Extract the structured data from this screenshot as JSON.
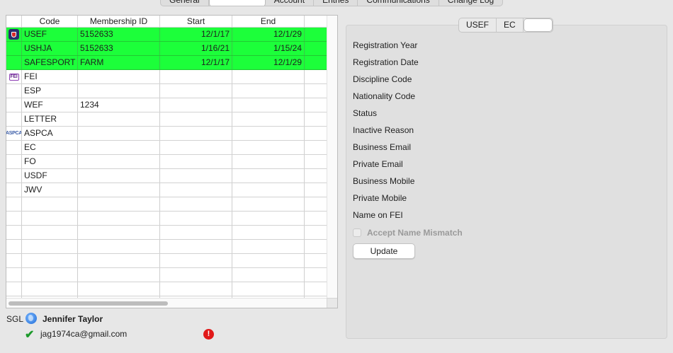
{
  "top_tabs": [
    "General",
    "",
    "Account",
    "Entries",
    "Communications",
    "Change Log"
  ],
  "table": {
    "headers": [
      "Code",
      "Membership ID",
      "Start",
      "End"
    ],
    "highlight_color": "#1cff3a",
    "rows": [
      {
        "icon": "usef-logo",
        "code": "USEF",
        "membership_id": "5152633",
        "start": "12/1/17",
        "end": "12/1/29",
        "highlight": true
      },
      {
        "icon": "",
        "code": "USHJA",
        "membership_id": "5152633",
        "start": "1/16/21",
        "end": "1/15/24",
        "highlight": true
      },
      {
        "icon": "",
        "code": "SAFESPORT",
        "membership_id": "FARM",
        "start": "12/1/17",
        "end": "12/1/29",
        "highlight": true
      },
      {
        "icon": "fei-logo",
        "code": "FEI",
        "membership_id": "",
        "start": "",
        "end": "",
        "highlight": false
      },
      {
        "icon": "",
        "code": "ESP",
        "membership_id": "",
        "start": "",
        "end": "",
        "highlight": false
      },
      {
        "icon": "",
        "code": "WEF",
        "membership_id": "1234",
        "start": "",
        "end": "",
        "highlight": false
      },
      {
        "icon": "",
        "code": "LETTER",
        "membership_id": "",
        "start": "",
        "end": "",
        "highlight": false
      },
      {
        "icon": "aspca-logo",
        "code": "ASPCA",
        "membership_id": "",
        "start": "",
        "end": "",
        "highlight": false
      },
      {
        "icon": "",
        "code": "EC",
        "membership_id": "",
        "start": "",
        "end": "",
        "highlight": false
      },
      {
        "icon": "",
        "code": "FO",
        "membership_id": "",
        "start": "",
        "end": "",
        "highlight": false
      },
      {
        "icon": "",
        "code": "USDF",
        "membership_id": "",
        "start": "",
        "end": "",
        "highlight": false
      },
      {
        "icon": "",
        "code": "JWV",
        "membership_id": "",
        "start": "",
        "end": "",
        "highlight": false
      },
      {
        "icon": "",
        "code": "",
        "membership_id": "",
        "start": "",
        "end": "",
        "highlight": false
      },
      {
        "icon": "",
        "code": "",
        "membership_id": "",
        "start": "",
        "end": "",
        "highlight": false
      },
      {
        "icon": "",
        "code": "",
        "membership_id": "",
        "start": "",
        "end": "",
        "highlight": false
      },
      {
        "icon": "",
        "code": "",
        "membership_id": "",
        "start": "",
        "end": "",
        "highlight": false
      },
      {
        "icon": "",
        "code": "",
        "membership_id": "",
        "start": "",
        "end": "",
        "highlight": false
      },
      {
        "icon": "",
        "code": "",
        "membership_id": "",
        "start": "",
        "end": "",
        "highlight": false
      },
      {
        "icon": "",
        "code": "",
        "membership_id": "",
        "start": "",
        "end": "",
        "highlight": false
      },
      {
        "icon": "",
        "code": "",
        "membership_id": "",
        "start": "",
        "end": "",
        "highlight": false
      }
    ]
  },
  "logos": {
    "fei": "FEI",
    "aspca": "ASPCA"
  },
  "person": {
    "prefix": "SGL",
    "name": "Jennifer Taylor",
    "email": "jag1974ca@gmail.com",
    "alert_glyph": "!"
  },
  "detail": {
    "segments": [
      "USEF",
      "EC",
      ""
    ],
    "fields": [
      "Registration Year",
      "Registration Date",
      "Discipline Code",
      "Nationality Code",
      "Status",
      "Inactive Reason",
      "Business Email",
      "Private Email",
      "Business Mobile",
      "Private Mobile",
      "Name on FEI"
    ],
    "accept_mismatch_label": "Accept Name Mismatch",
    "update_label": "Update"
  }
}
